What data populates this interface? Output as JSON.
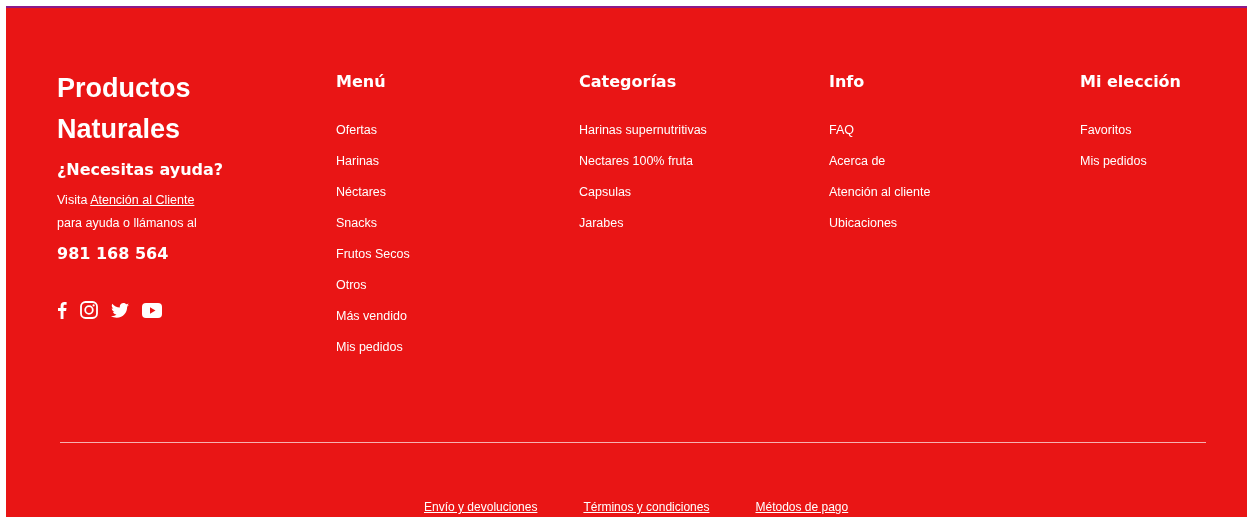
{
  "brand": {
    "title": "Productos Naturales"
  },
  "help": {
    "heading": "¿Necesitas ayuda?",
    "text_before": "Visita",
    "link": "Atención al Cliente",
    "text_after": "para ayuda o llámanos al",
    "phone": "981 168 564"
  },
  "social": [
    {
      "kind": "facebook"
    },
    {
      "kind": "instagram"
    },
    {
      "kind": "twitter"
    },
    {
      "kind": "youtube"
    }
  ],
  "columns": [
    {
      "heading": "Menú",
      "links": [
        "Ofertas",
        "Harinas",
        "Néctares",
        "Snacks",
        "Frutos Secos",
        "Otros",
        "Más vendido",
        "Mis pedidos"
      ]
    },
    {
      "heading": "Categorías",
      "links": [
        "Harinas supernutritivas",
        "Nectares 100% fruta",
        "Capsulas",
        "Jarabes"
      ]
    },
    {
      "heading": "Info",
      "links": [
        "FAQ",
        "Acerca de",
        "Atención al cliente",
        "Ubicaciones"
      ]
    },
    {
      "heading": "Mi elección",
      "links": [
        "Favoritos",
        "Mis pedidos"
      ]
    }
  ],
  "bottom_links": [
    "Envío y devoluciones",
    "Términos y condiciones",
    "Métodos de pago"
  ]
}
